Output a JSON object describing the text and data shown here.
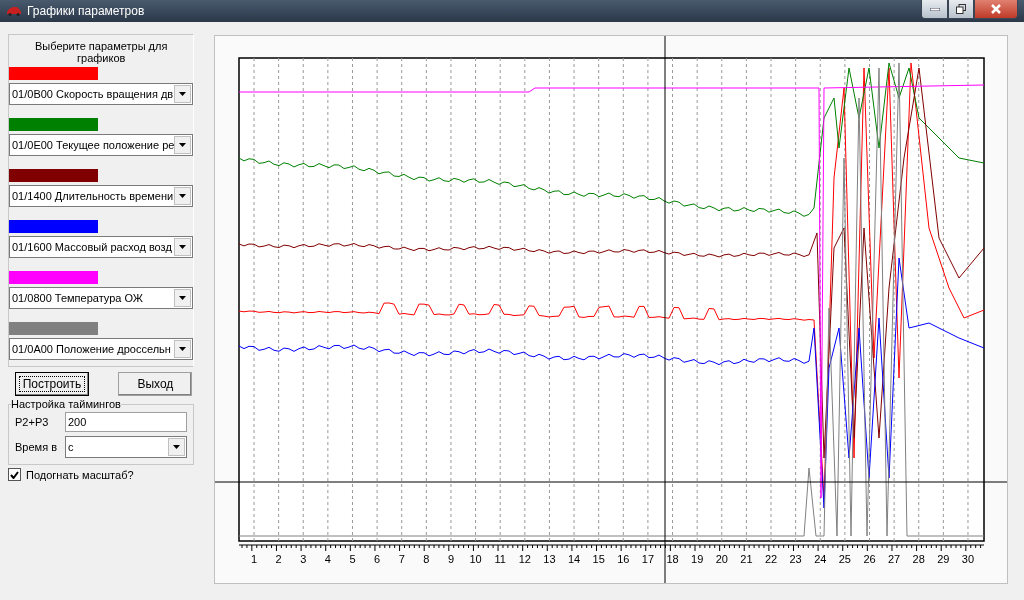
{
  "window": {
    "title": "Графики параметров"
  },
  "parameters": {
    "heading": "Выберите параметры для графиков",
    "items": [
      {
        "color": "#ff0000",
        "value": "01/0B00 Скорость вращения дв"
      },
      {
        "color": "#008000",
        "value": "01/0E00 Текущее положение ре"
      },
      {
        "color": "#800000",
        "value": "01/1400 Длительность времени"
      },
      {
        "color": "#0000ff",
        "value": "01/1600 Массовый расход возд"
      },
      {
        "color": "#ff00ff",
        "value": "01/0800 Температура ОЖ"
      },
      {
        "color": "#808080",
        "value": "01/0A00 Положение дроссельн"
      }
    ]
  },
  "buttons": [
    {
      "label": "Построить",
      "focused": true
    },
    {
      "label": "Выход",
      "focused": false
    }
  ],
  "timings": {
    "title": "Настройка таймингов",
    "p2p3_label": "P2+P3",
    "p2p3_value": "200",
    "time_label": "Время в",
    "time_value": "с"
  },
  "fit_scale": {
    "label": "Подогнать масштаб?",
    "checked": true
  },
  "chart": {
    "x_labels": [
      "1",
      "2",
      "3",
      "4",
      "5",
      "6",
      "7",
      "8",
      "9",
      "10",
      "11",
      "12",
      "13",
      "14",
      "15",
      "16",
      "17",
      "18",
      "19",
      "20",
      "21",
      "22",
      "23",
      "24",
      "25",
      "26",
      "27",
      "28",
      "29",
      "30"
    ]
  }
}
